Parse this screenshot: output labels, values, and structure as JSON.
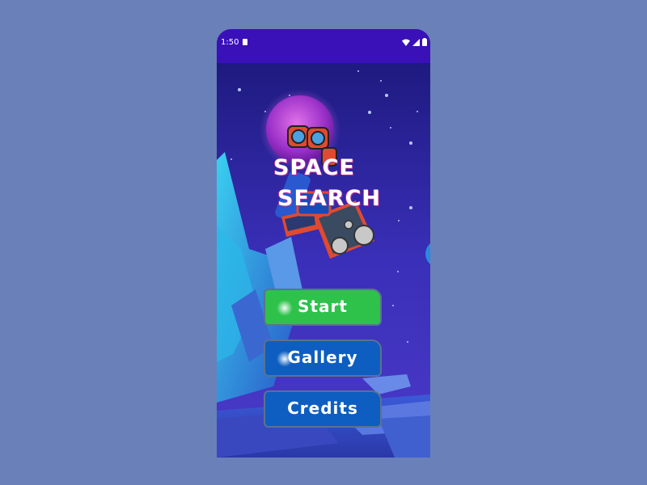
{
  "status_bar": {
    "time": "1:50",
    "icons": [
      "sim-card-icon",
      "wifi-icon",
      "signal-icon",
      "battery-icon"
    ]
  },
  "title": {
    "line1": "SPACE",
    "line2": "SEARCH"
  },
  "menu": {
    "start_label": "Start",
    "gallery_label": "Gallery",
    "credits_label": "Credits"
  },
  "colors": {
    "background": "#6a80b8",
    "status_bar": "#3a10b8",
    "start_button": "#2ec24a",
    "menu_button": "#0d5ec0",
    "title_shadow": "#c0309a"
  }
}
